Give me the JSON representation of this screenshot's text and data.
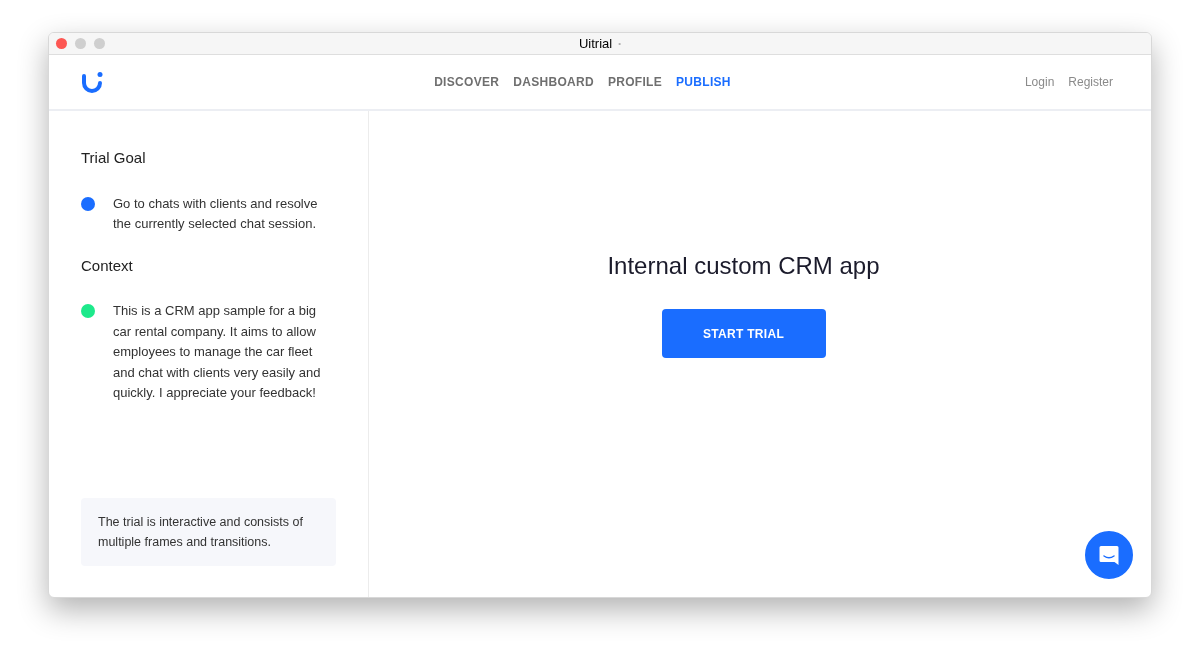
{
  "window": {
    "title": "Uitrial",
    "title_dot": "•"
  },
  "nav": {
    "items": [
      {
        "label": "DISCOVER",
        "selected": false
      },
      {
        "label": "DASHBOARD",
        "selected": false
      },
      {
        "label": "PROFILE",
        "selected": false
      },
      {
        "label": "PUBLISH",
        "selected": true
      }
    ],
    "auth": [
      "Login",
      "Register"
    ]
  },
  "sidebar": {
    "sections": [
      {
        "title": "Trial Goal",
        "text": "Go to chats with clients and resolve the currently selected chat session.",
        "color": "#1a6dff"
      },
      {
        "title": "Context",
        "text": "This is a CRM app sample for a big car rental company. It aims to allow employees to manage the car fleet and chat with clients very easily and quickly. I appreciate your feedback!",
        "color": "#1de98b"
      }
    ],
    "note": "The trial is interactive and consists of multiple frames and transitions."
  },
  "main": {
    "heading": "Internal custom CRM app",
    "button": "START TRIAL"
  }
}
